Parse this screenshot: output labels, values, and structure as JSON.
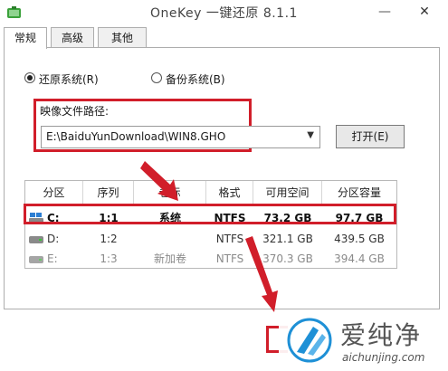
{
  "window": {
    "title": "OneKey 一键还原 8.1.1",
    "minimize": "—",
    "close": "✕"
  },
  "tabs": [
    {
      "label": "常规",
      "active": true
    },
    {
      "label": "高级",
      "active": false
    },
    {
      "label": "其他",
      "active": false
    }
  ],
  "mode": {
    "restore": {
      "label": "还原系统(R)",
      "checked": true
    },
    "backup": {
      "label": "备份系统(B)",
      "checked": false
    }
  },
  "image_path": {
    "label": "映像文件路径:",
    "value": "E:\\BaiduYunDownload\\WIN8.GHO",
    "open_button": "打开(E)"
  },
  "partition_table": {
    "columns": [
      "分区",
      "序列",
      "卷标",
      "格式",
      "可用空间",
      "分区容量"
    ],
    "rows": [
      {
        "drive": "C:",
        "index": "1:1",
        "label": "系统",
        "format": "NTFS",
        "free": "73.2 GB",
        "size": "97.7 GB",
        "selected": true
      },
      {
        "drive": "D:",
        "index": "1:2",
        "label": "",
        "format": "NTFS",
        "free": "321.1 GB",
        "size": "439.5 GB",
        "selected": false
      },
      {
        "drive": "E:",
        "index": "1:3",
        "label": "新加卷",
        "format": "NTFS",
        "free": "370.3 GB",
        "size": "394.4 GB",
        "selected": false
      }
    ]
  },
  "watermark": {
    "brand": "爱纯净",
    "url": "aichunjing.com"
  },
  "colors": {
    "highlight": "#d11e2a"
  }
}
